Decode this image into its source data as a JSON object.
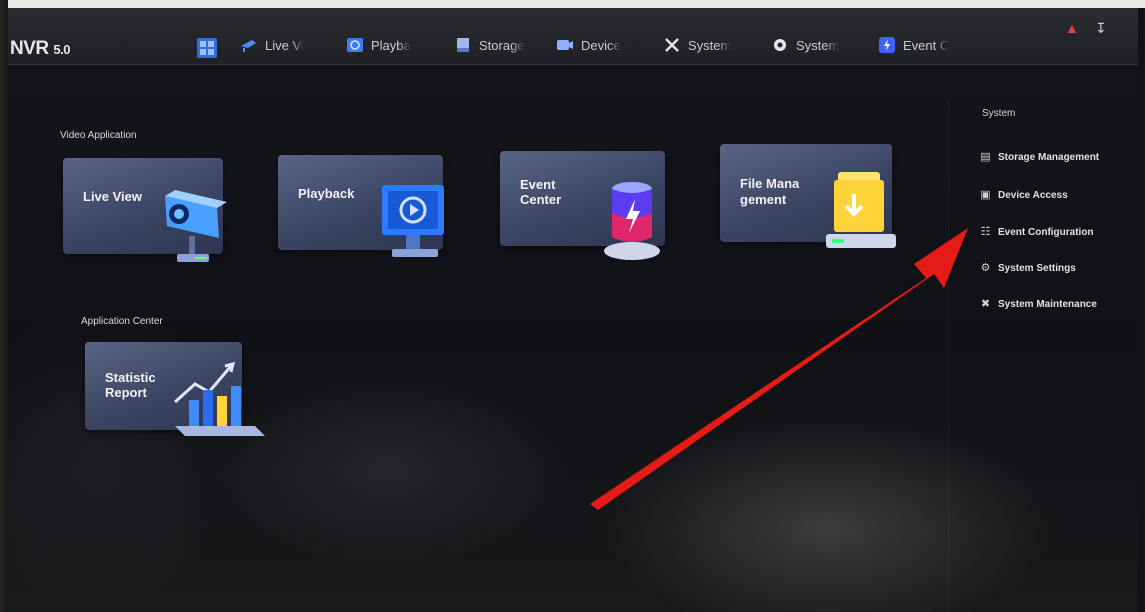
{
  "header": {
    "brand": "NVR",
    "brand_version": "5.0",
    "tabs": [
      {
        "label": "Live Vi",
        "icon": "camera-icon",
        "color": "#4a8cff"
      },
      {
        "label": "Playba",
        "icon": "playback-icon",
        "color": "#3b7bff"
      },
      {
        "label": "Storage",
        "icon": "storage-icon",
        "color": "#9fb6e8"
      },
      {
        "label": "Device",
        "icon": "device-icon",
        "color": "#8fb0ff"
      },
      {
        "label": "System",
        "icon": "tools-icon",
        "color": "#e6e6e6"
      },
      {
        "label": "System",
        "icon": "gear-icon",
        "color": "#e6e6e6"
      },
      {
        "label": "Event C",
        "icon": "event-icon",
        "color": "#3f62ff"
      }
    ],
    "right_icons": [
      "alarm-bell-icon",
      "download-icon"
    ]
  },
  "main": {
    "video_application_title": "Video Application",
    "application_center_title": "Application Center",
    "tiles": {
      "live_view": "Live View",
      "playback": "Playback",
      "event_center": "Event\nCenter",
      "file_management": "File Mana\ngement",
      "statistic_report": "Statistic\nReport"
    }
  },
  "sidebar": {
    "title": "System",
    "items": [
      {
        "label": "Storage Management",
        "icon": "storage-management-icon"
      },
      {
        "label": "Device Access",
        "icon": "device-access-icon"
      },
      {
        "label": "Event Configuration",
        "icon": "event-configuration-icon"
      },
      {
        "label": "System Settings",
        "icon": "settings-gear-icon"
      },
      {
        "label": "System Maintenance",
        "icon": "maintenance-tools-icon"
      }
    ]
  },
  "colors": {
    "accent_blue": "#2f6fe0",
    "annotation_arrow": "#e41b17",
    "tile_bg": "#3b4563"
  }
}
